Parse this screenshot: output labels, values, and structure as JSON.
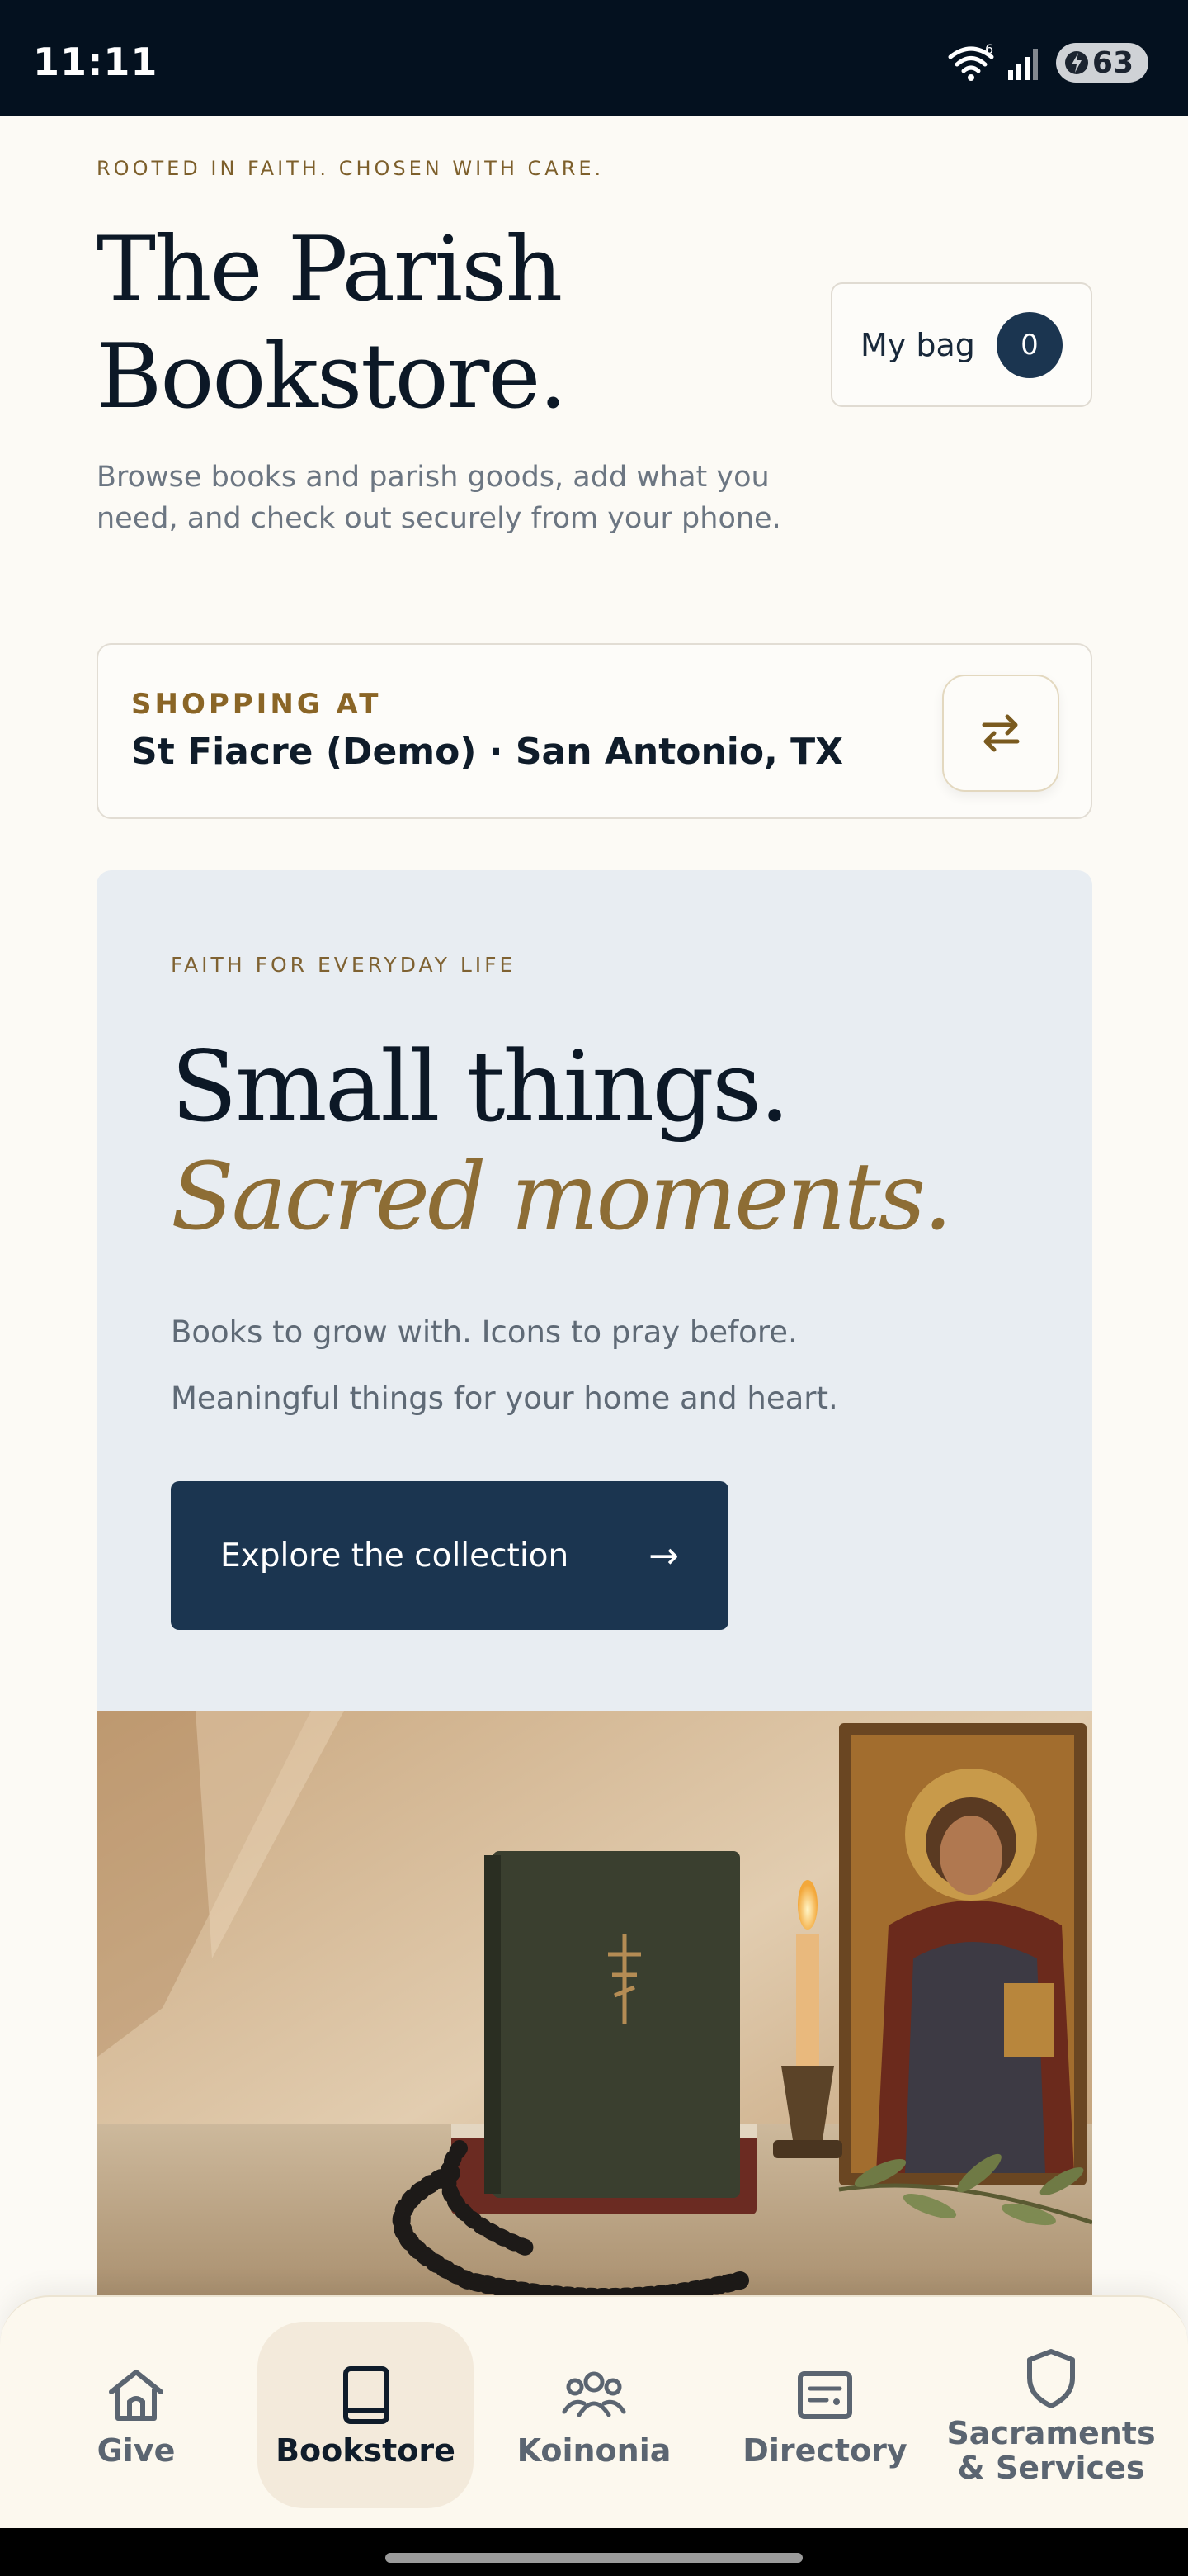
{
  "status_bar": {
    "time": "11:11",
    "network_badge": "6",
    "battery_level": "63"
  },
  "header": {
    "tagline": "ROOTED IN FAITH. CHOSEN WITH CARE.",
    "title_line1": "The Parish",
    "title_line2": "Bookstore.",
    "description": "Browse books and parish goods, add what you need, and check out securely from your phone.",
    "bag": {
      "label": "My bag",
      "count": "0"
    }
  },
  "shopping_at": {
    "label": "SHOPPING AT",
    "location": "St Fiacre (Demo) · San Antonio, TX"
  },
  "hero": {
    "eyebrow": "FAITH FOR EVERYDAY LIFE",
    "headline_line1": "Small things.",
    "headline_line2": "Sacred moments.",
    "body_line1": "Books to grow with. Icons to pray before.",
    "body_line2": "Meaningful things for your home and heart.",
    "cta_label": "Explore the collection",
    "cta_arrow": "→"
  },
  "bottom_nav": {
    "items": [
      {
        "label": "Give",
        "icon": "church-icon",
        "active": false
      },
      {
        "label": "Bookstore",
        "icon": "book-icon",
        "active": true
      },
      {
        "label": "Koinonia",
        "icon": "people-icon",
        "active": false
      },
      {
        "label": "Directory",
        "icon": "directory-card-icon",
        "active": false
      },
      {
        "label_line1": "Sacraments",
        "label_line2": "& Services",
        "icon": "shield-icon",
        "active": false
      }
    ]
  },
  "colors": {
    "navy": "#1b3550",
    "gold": "#8d6d35",
    "background": "#fcfaf5",
    "hero_background": "#e8edf2"
  }
}
